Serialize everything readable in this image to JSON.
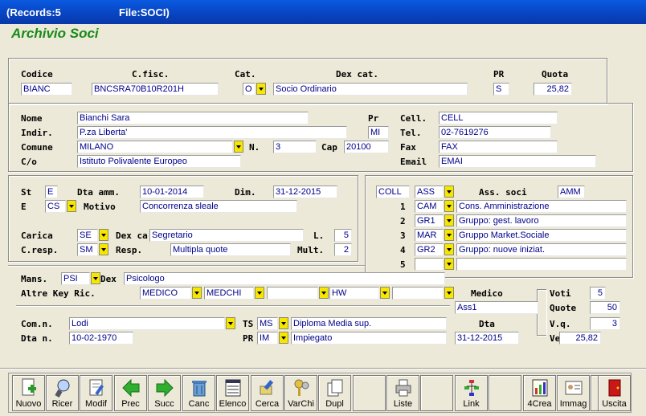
{
  "window": {
    "records": "(Records:5",
    "file": "File:SOCI)"
  },
  "app_title": "Archivio Soci",
  "header": {
    "codice_label": "Codice",
    "cfisc_label": "C.fisc.",
    "cat_label": "Cat.",
    "dexcat_label": "Dex cat.",
    "pr_label": "PR",
    "quota_label": "Quota",
    "codice": "BIANC",
    "cfisc": "BNCSRA70B10R201H",
    "cat": "O",
    "dexcat": "Socio Ordinario",
    "pr": "S",
    "quota": "25,82"
  },
  "anag": {
    "nome_label": "Nome",
    "indir_label": "Indir.",
    "comune_label": "Comune",
    "co_label": "C/o",
    "pr_label": "Pr",
    "n_label": "N.",
    "cap_label": "Cap",
    "cell_label": "Cell.",
    "tel_label": "Tel.",
    "fax_label": "Fax",
    "email_label": "Email",
    "nome": "Bianchi Sara",
    "indir": "P.za Liberta'",
    "comune": "MILANO",
    "co": "Istituto Polivalente Europeo",
    "pr": "MI",
    "n": "3",
    "cap": "20100",
    "cell": "CELL",
    "tel": "02-7619276",
    "fax": "FAX",
    "email": "EMAI"
  },
  "stato": {
    "st_label": "St",
    "dta_amm_label": "Dta amm.",
    "dim_label": "Dim.",
    "e_label": "E",
    "motivo_label": "Motivo",
    "carica_label": "Carica",
    "dexca_label": "Dex ca",
    "l_label": "L.",
    "cresp_label": "C.resp.",
    "resp_label": "Resp.",
    "mult_label": "Mult.",
    "st": "E",
    "dta_amm": "10-01-2014",
    "dim": "31-12-2015",
    "e": "CS",
    "motivo": "Concorrenza sleale",
    "carica": "SE",
    "dexca": "Segretario",
    "l": "5",
    "cresp": "SM",
    "resp": "Multipla quote",
    "mult": "2"
  },
  "assoc": {
    "coll": "COLL",
    "ass": "ASS",
    "ass_soci_label": "Ass. soci",
    "amm": "AMM",
    "rows": [
      {
        "n": "1",
        "code": "CAM",
        "desc": "Cons. Amministrazione"
      },
      {
        "n": "2",
        "code": "GR1",
        "desc": "Gruppo: gest. lavoro"
      },
      {
        "n": "3",
        "code": "MAR",
        "desc": "Gruppo Market.Sociale"
      },
      {
        "n": "4",
        "code": "GR2",
        "desc": "Gruppo: nuove iniziat."
      },
      {
        "n": "5",
        "code": "",
        "desc": ""
      }
    ]
  },
  "altre": {
    "mans_label": "Mans.",
    "dex_label": "Dex",
    "altre_label": "Altre Key Ric.",
    "medico_label": "Medico",
    "mans": "PSI",
    "dex": "Psicologo",
    "k1": "MEDICO",
    "k2": "MEDCHI",
    "k3": "",
    "k4": "HW",
    "k5": "",
    "medico": "Ass1",
    "comn_label": "Com.n.",
    "ts_label": "TS",
    "dtan_label": "Dta n.",
    "pr_label": "PR",
    "dta_label": "Dta",
    "comn": "Lodi",
    "ts": "MS",
    "ts_desc": "Diploma Media sup.",
    "dtan": "10-02-1970",
    "pr": "IM",
    "pr_desc": "Impiegato",
    "dta": "31-12-2015",
    "voti_label": "Voti",
    "quote_label": "Quote",
    "vq_label": "V.q.",
    "ve_label": "Ve",
    "voti": "5",
    "quote": "50",
    "vq": "3",
    "ve": "25,82"
  },
  "toolbar": [
    {
      "label": "Nuovo",
      "icon": "new-icon"
    },
    {
      "label": "Ricer",
      "icon": "search-icon"
    },
    {
      "label": "Modif",
      "icon": "edit-icon"
    },
    {
      "label": "Prec",
      "icon": "arrow-left-icon"
    },
    {
      "label": "Succ",
      "icon": "arrow-right-icon"
    },
    {
      "label": "Canc",
      "icon": "trash-icon"
    },
    {
      "label": "Elenco",
      "icon": "list-icon"
    },
    {
      "label": "Cerca",
      "icon": "find-icon"
    },
    {
      "label": "VarChi",
      "icon": "keys-icon"
    },
    {
      "label": "Dupl",
      "icon": "duplicate-icon"
    },
    {
      "label": "",
      "icon": ""
    },
    {
      "label": "Liste",
      "icon": "printer-icon"
    },
    {
      "label": "",
      "icon": ""
    },
    {
      "label": "Link",
      "icon": "tree-icon"
    },
    {
      "label": "",
      "icon": ""
    },
    {
      "label": "4Crea",
      "icon": "chart-icon"
    },
    {
      "label": "Immag",
      "icon": "id-card-icon"
    },
    {
      "label": "",
      "icon": ""
    },
    {
      "label": "Uscita",
      "icon": "exit-door-icon"
    }
  ]
}
